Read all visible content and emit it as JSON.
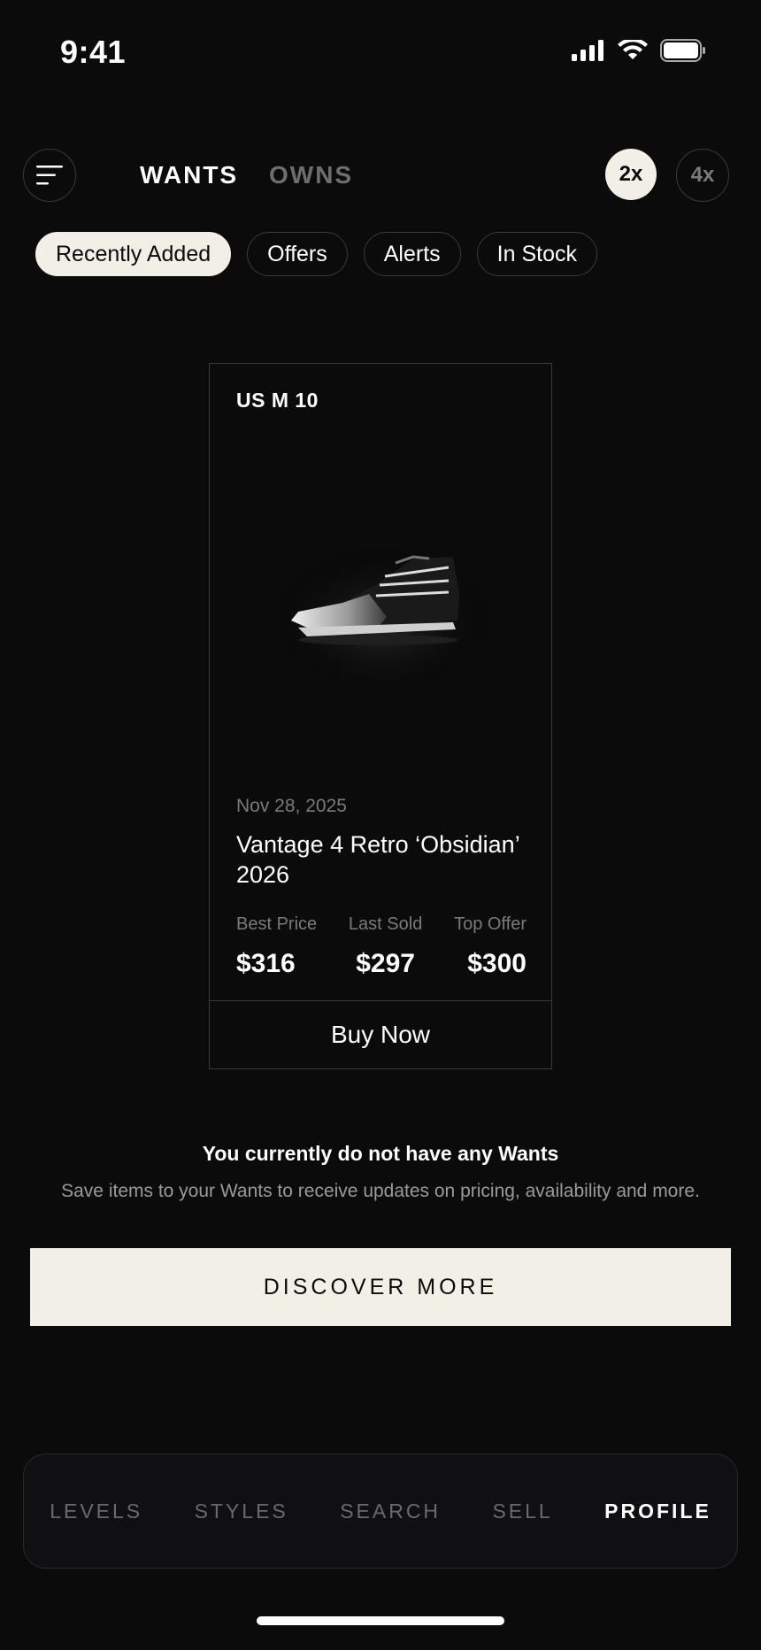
{
  "status_bar": {
    "time": "9:41"
  },
  "header": {
    "tabs": [
      {
        "label": "WANTS",
        "active": true
      },
      {
        "label": "OWNS",
        "active": false
      }
    ],
    "zoom_options": [
      {
        "label": "2x",
        "active": true
      },
      {
        "label": "4x",
        "active": false
      }
    ]
  },
  "chips": [
    {
      "label": "Recently Added",
      "active": true
    },
    {
      "label": "Offers",
      "active": false
    },
    {
      "label": "Alerts",
      "active": false
    },
    {
      "label": "In Stock",
      "active": false
    }
  ],
  "card": {
    "size": "US M 10",
    "date": "Nov 28, 2025",
    "name": "Vantage 4 Retro ‘Obsidian’ 2026",
    "stats": [
      {
        "label": "Best Price",
        "value": "$316"
      },
      {
        "label": "Last Sold",
        "value": "$297"
      },
      {
        "label": "Top Offer",
        "value": "$300"
      }
    ],
    "buy_label": "Buy Now"
  },
  "empty_state": {
    "title": "You currently do not have any Wants",
    "subtitle": "Save items to your Wants to receive updates on pricing, availability and more.",
    "cta": "DISCOVER MORE"
  },
  "bottom_nav": [
    {
      "label": "LEVELS",
      "active": false
    },
    {
      "label": "STYLES",
      "active": false
    },
    {
      "label": "SEARCH",
      "active": false
    },
    {
      "label": "SELL",
      "active": false
    },
    {
      "label": "PROFILE",
      "active": true
    }
  ],
  "colors": {
    "background": "#0b0b0b",
    "accent": "#f2efe7",
    "muted": "#7a7a7a",
    "border": "#3a3a3a"
  }
}
